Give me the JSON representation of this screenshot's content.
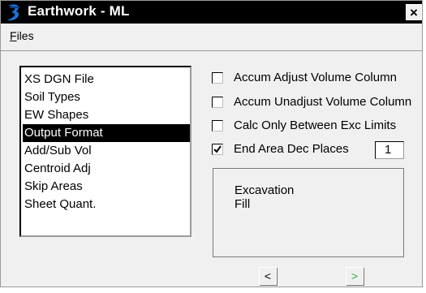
{
  "window": {
    "title": "Earthwork - ML",
    "close_glyph": "×",
    "logo_icon": "geopak-logo-icon"
  },
  "menu": {
    "files_mnemonic": "F",
    "files_rest": "iles"
  },
  "list": {
    "items": [
      "XS DGN File",
      "Soil Types",
      "EW Shapes",
      "Output Format",
      "Add/Sub Vol",
      "Centroid Adj",
      "Skip Areas",
      "Sheet Quant."
    ],
    "selected_index": 3
  },
  "options": [
    {
      "label": "Accum Adjust Volume Column",
      "checked": false
    },
    {
      "label": "Accum Unadjust Volume Column",
      "checked": false
    },
    {
      "label": "Calc Only Between Exc Limits",
      "checked": false
    },
    {
      "label": "End Area Dec Places",
      "checked": true
    }
  ],
  "dec_places_value": "1",
  "preview": {
    "lines": [
      "Excavation",
      "Fill"
    ]
  },
  "nav": {
    "prev_glyph": "<",
    "next_glyph": ">",
    "next_color": "#2db34a"
  },
  "colors": {
    "titlebar": "#000000",
    "window_bg": "#f0f0f0",
    "selection": "#000000"
  }
}
